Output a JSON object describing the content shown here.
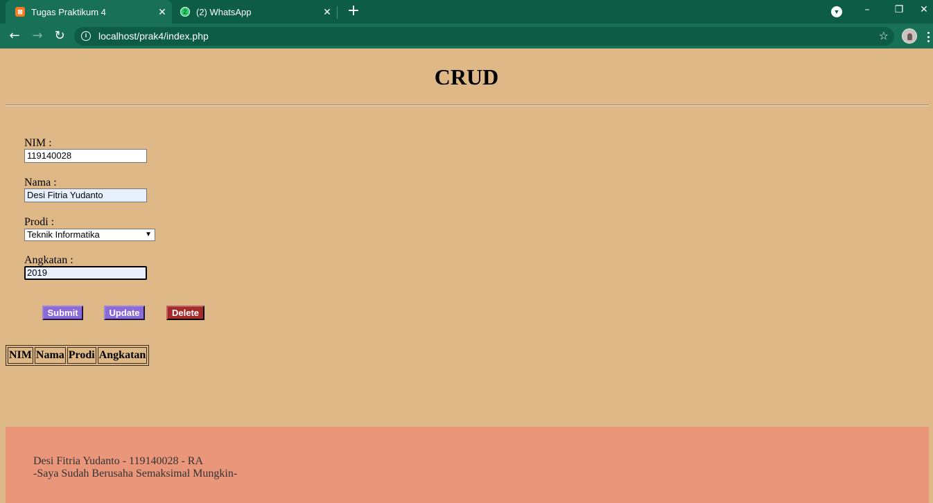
{
  "browser": {
    "tabs": [
      {
        "title": "Tugas Praktikum 4",
        "favicon": "xampp-icon",
        "active": true
      },
      {
        "title": "(2) WhatsApp",
        "favicon": "whatsapp-icon",
        "badge": "2",
        "active": false
      }
    ],
    "url": "localhost/prak4/index.php",
    "window_controls": {
      "minimize": "–",
      "restore": "❐",
      "close": "✕"
    }
  },
  "page": {
    "title": "CRUD",
    "form": {
      "nim_label": "NIM :",
      "nim_value": "119140028",
      "nama_label": "Nama :",
      "nama_value": "Desi Fitria Yudanto",
      "prodi_label": "Prodi :",
      "prodi_selected": "Teknik Informatika",
      "angkatan_label": "Angkatan :",
      "angkatan_value": "2019"
    },
    "buttons": {
      "submit": "Submit",
      "update": "Update",
      "delete": "Delete"
    },
    "table": {
      "headers": [
        "NIM",
        "Nama",
        "Prodi",
        "Angkatan"
      ]
    },
    "footer": {
      "line1": "Desi Fitria Yudanto - 119140028 - RA",
      "line2": "-Saya Sudah Berusaha Semaksimal Mungkin-"
    }
  },
  "colors": {
    "page_bg": "#deb887",
    "footer_bg": "#e9967a",
    "button_purple": "#8a6ad8",
    "button_red": "#a52a2a",
    "chrome_green": "#0d5c45"
  }
}
